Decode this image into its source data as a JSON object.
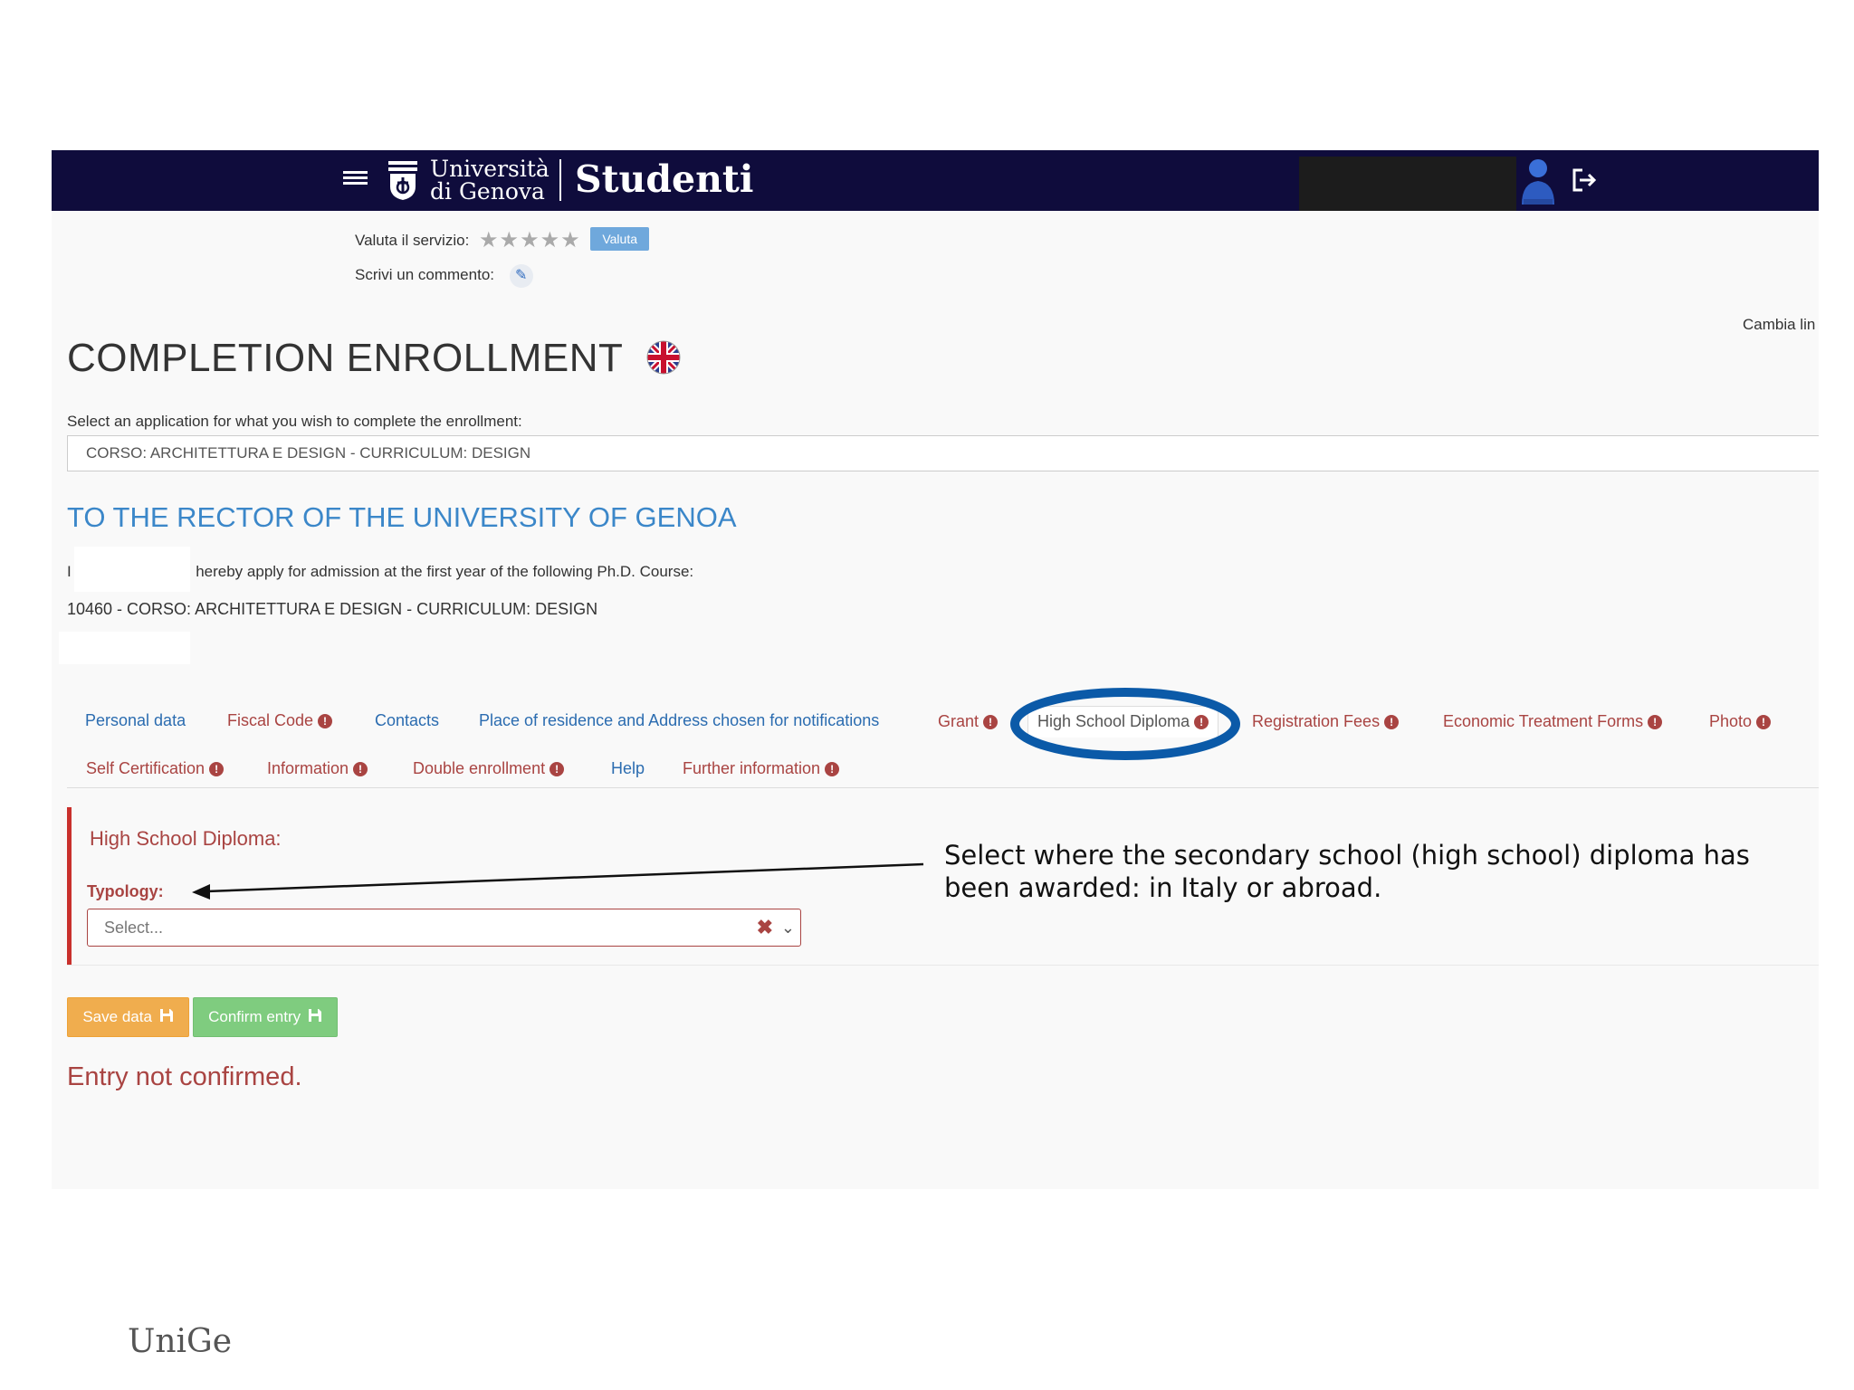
{
  "header": {
    "logo_line1": "Università",
    "logo_line2": "di Genova",
    "app_name": "Studenti"
  },
  "rating": {
    "label": "Valuta il servizio:",
    "stars": "★★★★★",
    "rating_value": 0,
    "button": "Valuta",
    "comment_label": "Scrivi un commento:"
  },
  "language_link": "Cambia lin",
  "page_title": "COMPLETION ENROLLMENT",
  "application_select": {
    "label": "Select an application for what you wish to complete the enrollment:",
    "value": "CORSO: ARCHITETTURA E DESIGN - CURRICULUM: DESIGN"
  },
  "rector_heading": "TO THE RECTOR OF THE UNIVERSITY OF GENOA",
  "apply_text_prefix": "I",
  "apply_text": "hereby apply for admission at the first year of the following Ph.D. Course:",
  "course": "10460 - CORSO: ARCHITETTURA E DESIGN - CURRICULUM: DESIGN",
  "tabs": [
    {
      "label": "Personal data",
      "status": "ok"
    },
    {
      "label": "Fiscal Code",
      "status": "warning"
    },
    {
      "label": "Contacts",
      "status": "ok"
    },
    {
      "label": "Place of residence and Address chosen for notifications",
      "status": "ok"
    },
    {
      "label": "Grant",
      "status": "warning"
    },
    {
      "label": "High School Diploma",
      "status": "warning",
      "active": true
    },
    {
      "label": "Registration Fees",
      "status": "warning"
    },
    {
      "label": "Economic Treatment Forms",
      "status": "warning"
    },
    {
      "label": "Photo",
      "status": "warning"
    },
    {
      "label": "Self Certification",
      "status": "warning"
    },
    {
      "label": "Information",
      "status": "warning"
    },
    {
      "label": "Double enrollment",
      "status": "warning"
    },
    {
      "label": "Help",
      "status": "ok"
    },
    {
      "label": "Further information",
      "status": "warning"
    }
  ],
  "warning_glyph": "!",
  "diploma_panel": {
    "title": "High School Diploma:",
    "typology_label": "Typology:",
    "select_placeholder": "Select...",
    "clear_glyph": "✖",
    "chevron_glyph": "⌄"
  },
  "buttons": {
    "save": "Save data",
    "confirm": "Confirm entry"
  },
  "status_message": "Entry not confirmed.",
  "callout": "Select where the secondary school (high school) diploma has been awarded: in Italy or abroad.",
  "footer_brand": "UniGe",
  "colors": {
    "navbar": "#0f0c3c",
    "link_blue": "#2b6cb0",
    "error_red": "#a94442",
    "heading_blue": "#3b87c9",
    "save_orange": "#f0ad4e",
    "confirm_green": "#7fcc7f",
    "highlight_ellipse": "#0b5aa8"
  },
  "icons": [
    "hamburger-menu-icon",
    "university-emblem-icon",
    "user-avatar-icon",
    "logout-icon",
    "pencil-icon",
    "uk-flag-icon",
    "warning-icon",
    "floppy-disk-icon",
    "clear-icon",
    "chevron-down-icon"
  ]
}
